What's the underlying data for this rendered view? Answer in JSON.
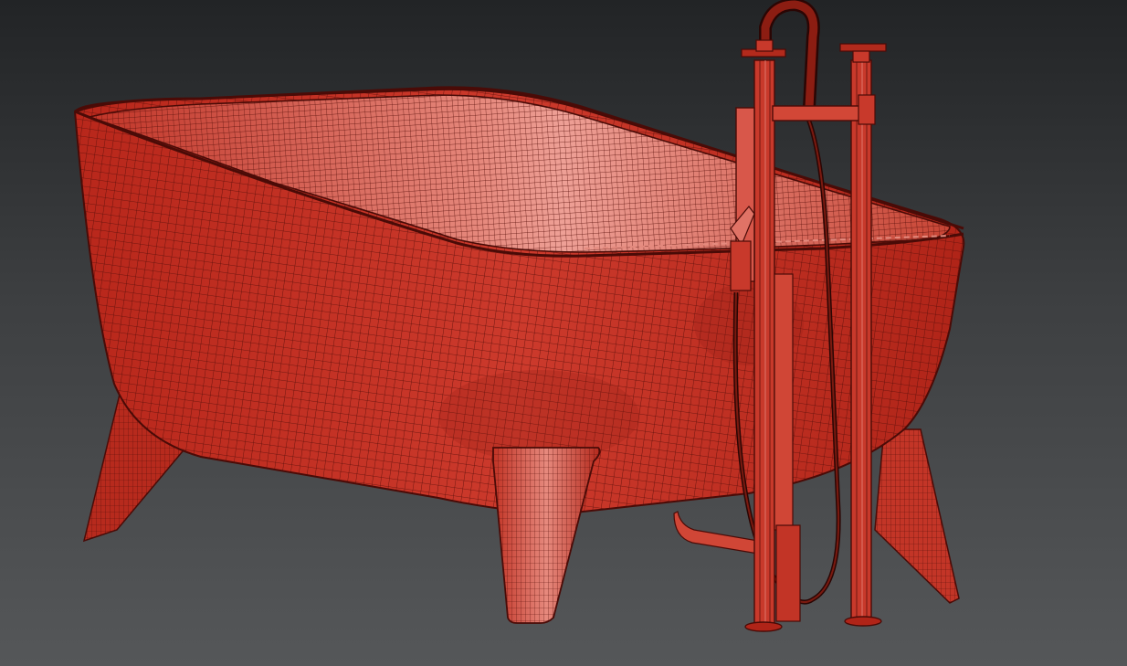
{
  "viewport": {
    "background_top": "#222426",
    "background_bottom": "#555759",
    "render_mode": "shaded-wireframe",
    "mesh_color": "#c7392c",
    "wire_color": "#5a0f0a",
    "highlight_color": "#e8887c"
  },
  "model": {
    "objects": [
      "bathtub",
      "freestanding-faucet",
      "shower-hose",
      "drain-pipe"
    ]
  }
}
